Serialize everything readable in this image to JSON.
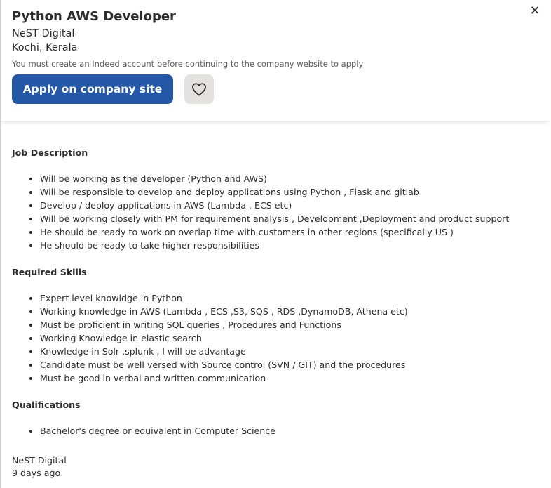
{
  "header": {
    "title": "Python AWS Developer",
    "company": "NeST Digital",
    "location": "Kochi, Kerala",
    "notice": "You must create an Indeed account before continuing to the company website to apply",
    "apply_label": "Apply on company site",
    "close_glyph": "✕",
    "save_icon": "heart-icon",
    "apply_color": "#2557a7"
  },
  "sections": [
    {
      "title": "Job Description",
      "items": [
        "Will be working as the developer (Python and AWS)",
        "Will be responsible to develop and deploy applications using Python , Flask and gitlab",
        "Develop / deploy applications in AWS (Lambda , ECS etc)",
        "Will be working closely with PM for requirement analysis , Development ,Deployment and product support",
        "He should be ready to work on overlap time with customers in other regions (specifically US )",
        "He should be ready to take higher responsibilities"
      ]
    },
    {
      "title": "Required Skills",
      "items": [
        "Expert level knowldge in Python",
        "Working knowledge in AWS (Lambda , ECS ,S3, SQS , RDS ,DynamoDB, Athena etc)",
        "Must be proficient in writing SQL queries , Procedures and Functions",
        "Working Knowledge in elastic search",
        "Knowledge in Solr ,splunk , l will be advantage",
        "Candidate must be well versed with Source control (SVN / GIT) and the procedures",
        "Must be good in verbal and written communication"
      ]
    },
    {
      "title": "Qualifications",
      "items": [
        "Bachelor's degree or equivalent in Computer Science"
      ]
    }
  ],
  "footer": {
    "company": "NeST Digital",
    "posted": "9 days ago"
  }
}
